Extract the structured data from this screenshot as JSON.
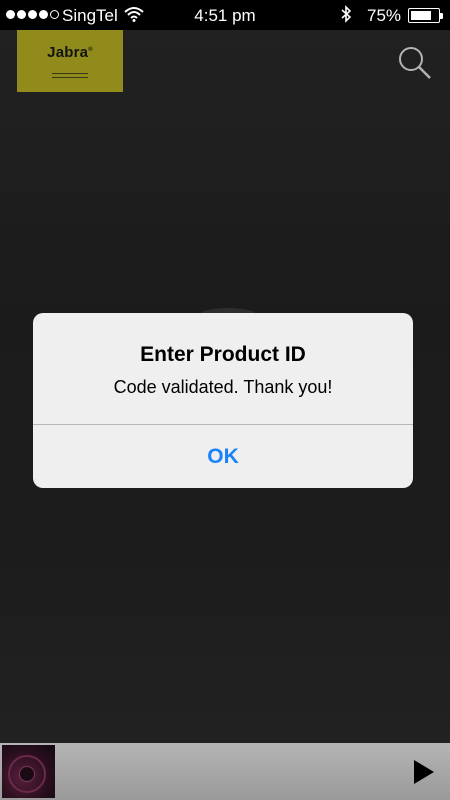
{
  "status_bar": {
    "signal_dots": [
      true,
      true,
      true,
      true,
      false
    ],
    "carrier": "SingTel",
    "wifi_icon": "wifi-icon",
    "time": "4:51 pm",
    "bluetooth_icon": "bluetooth-icon",
    "battery_percent": "75%",
    "battery_level": 0.75
  },
  "header": {
    "logo_text": "Jabra",
    "logo_registered": "®",
    "search_icon": "search-icon"
  },
  "alert": {
    "title": "Enter Product ID",
    "message": "Code validated. Thank you!",
    "ok_label": "OK"
  },
  "player": {
    "album_art_icon": "album-art",
    "play_icon": "play-icon"
  },
  "colors": {
    "brand": "#b9b323",
    "accent": "#1a82fb",
    "background": "#262626"
  }
}
